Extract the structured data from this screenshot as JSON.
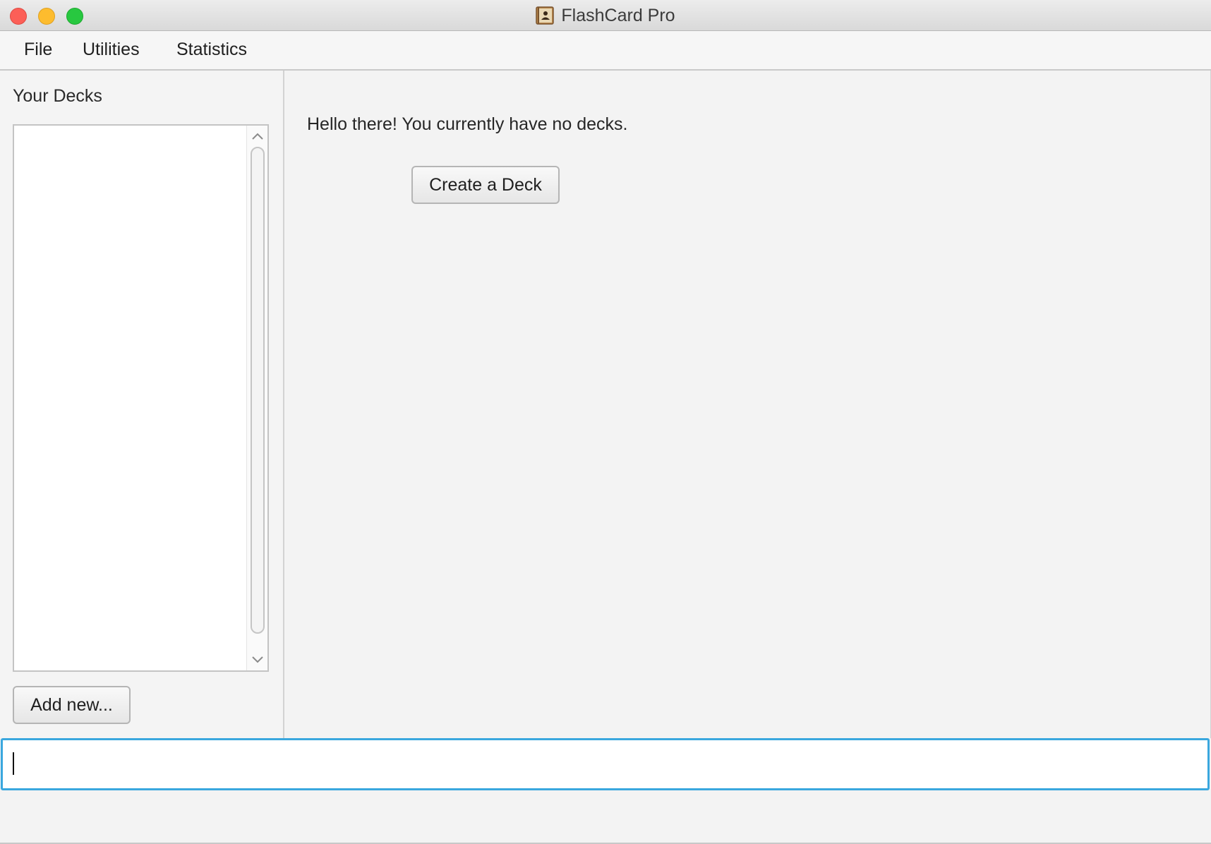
{
  "window": {
    "title": "FlashCard Pro"
  },
  "menubar": {
    "items": [
      {
        "label": "File"
      },
      {
        "label": "Utilities"
      },
      {
        "label": "Statistics"
      }
    ]
  },
  "sidebar": {
    "title": "Your Decks",
    "decks": [],
    "add_button_label": "Add new..."
  },
  "main": {
    "greeting": "Hello there! You currently have no decks.",
    "create_button_label": "Create a Deck"
  },
  "command_input": {
    "value": "",
    "focused": true
  },
  "icons": {
    "app": "flashcard-book-icon",
    "scroll_up": "chevron-up-icon",
    "scroll_down": "chevron-down-icon"
  },
  "colors": {
    "focus_ring": "#3aa7de",
    "close": "#fc5f57",
    "minimize": "#fdbc2e",
    "zoom": "#28c840"
  }
}
